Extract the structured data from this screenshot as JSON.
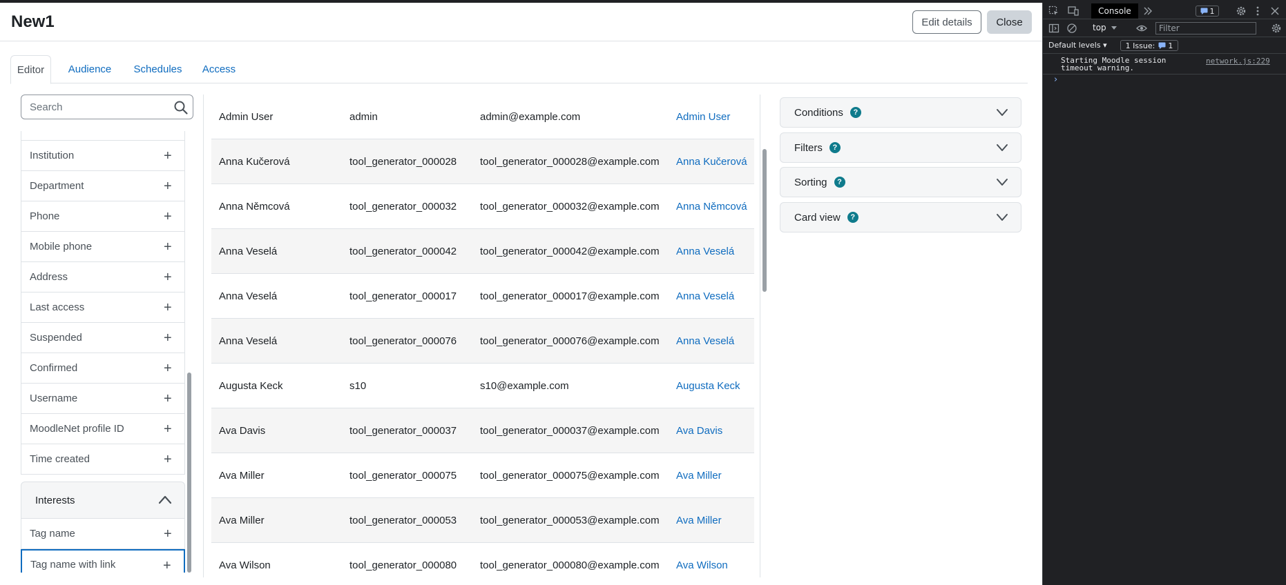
{
  "page": {
    "title": "New1"
  },
  "header": {
    "edit_label": "Edit details",
    "close_label": "Close"
  },
  "tabs": [
    {
      "label": "Editor",
      "active": true
    },
    {
      "label": "Audience",
      "active": false
    },
    {
      "label": "Schedules",
      "active": false
    },
    {
      "label": "Access",
      "active": false
    }
  ],
  "sidebar": {
    "search_placeholder": "Search",
    "items": [
      {
        "label": "Institution"
      },
      {
        "label": "Department"
      },
      {
        "label": "Phone"
      },
      {
        "label": "Mobile phone"
      },
      {
        "label": "Address"
      },
      {
        "label": "Last access"
      },
      {
        "label": "Suspended"
      },
      {
        "label": "Confirmed"
      },
      {
        "label": "Username"
      },
      {
        "label": "MoodleNet profile ID"
      },
      {
        "label": "Time created"
      }
    ],
    "group": {
      "label": "Interests",
      "items": [
        {
          "label": "Tag name"
        },
        {
          "label": "Tag name with link"
        }
      ]
    }
  },
  "table": {
    "rows": [
      [
        "Admin User",
        "admin",
        "admin@example.com",
        "Admin User"
      ],
      [
        "Anna Kučerová",
        "tool_generator_000028",
        "tool_generator_000028@example.com",
        "Anna Kučerová"
      ],
      [
        "Anna Němcová",
        "tool_generator_000032",
        "tool_generator_000032@example.com",
        "Anna Němcová"
      ],
      [
        "Anna Veselá",
        "tool_generator_000042",
        "tool_generator_000042@example.com",
        "Anna Veselá"
      ],
      [
        "Anna Veselá",
        "tool_generator_000017",
        "tool_generator_000017@example.com",
        "Anna Veselá"
      ],
      [
        "Anna Veselá",
        "tool_generator_000076",
        "tool_generator_000076@example.com",
        "Anna Veselá"
      ],
      [
        "Augusta Keck",
        "s10",
        "s10@example.com",
        "Augusta Keck"
      ],
      [
        "Ava Davis",
        "tool_generator_000037",
        "tool_generator_000037@example.com",
        "Ava Davis"
      ],
      [
        "Ava Miller",
        "tool_generator_000075",
        "tool_generator_000075@example.com",
        "Ava Miller"
      ],
      [
        "Ava Miller",
        "tool_generator_000053",
        "tool_generator_000053@example.com",
        "Ava Miller"
      ],
      [
        "Ava Wilson",
        "tool_generator_000080",
        "tool_generator_000080@example.com",
        "Ava Wilson"
      ]
    ]
  },
  "settings": {
    "panels": [
      {
        "label": "Conditions",
        "help": "?"
      },
      {
        "label": "Filters",
        "help": "?"
      },
      {
        "label": "Sorting",
        "help": "?"
      },
      {
        "label": "Card view",
        "help": "?"
      }
    ]
  },
  "devtools": {
    "tab_label": "Console",
    "badge_count": "1",
    "context": "top",
    "filter_placeholder": "Filter",
    "levels_label": "Default levels",
    "issue_label": "1 Issue:",
    "issue_count": "1",
    "log_message_line1": "Starting Moodle session",
    "log_message_line2": "timeout warning.",
    "log_source": "network.js:229",
    "prompt": "›"
  },
  "colors": {
    "link": "#0f6cbf",
    "help_badge": "#0f7b8c",
    "devtools_bg": "#202124"
  },
  "icons": {
    "search": "search-icon",
    "add": "plus-icon",
    "collapse": "chevron-up-icon",
    "expand": "chevron-down-icon"
  }
}
